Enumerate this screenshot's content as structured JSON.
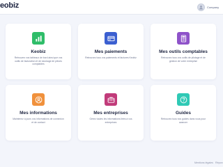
{
  "header": {
    "logo_text": "eobiz",
    "company_label": "Company"
  },
  "cards": [
    {
      "title": "Keobiz",
      "description": "Retrouvez vos tableaux de bord ainsi que vos outils de facturation et de stockage de pièces comptables",
      "color": "#2fbd69",
      "icon": "bar-chart-icon"
    },
    {
      "title": "Mes paiements",
      "description": "Retrouvez tous vos paiements et factures Keobiz",
      "color": "#3b5fd0",
      "icon": "credit-card-icon"
    },
    {
      "title": "Mes outils comptables",
      "description": "Retrouvez tous vos outils de pilotage et de gestion de votre entreprise",
      "color": "#8e52c9",
      "icon": "calculator-icon"
    },
    {
      "title": "Mes informations",
      "description": "Maintenez à jours vos informations de connexion et de contact",
      "color": "#f0913c",
      "icon": "user-icon"
    },
    {
      "title": "Mes entreprises",
      "description": "Gérez toutes les informations liées à vos entreprises",
      "color": "#c13b7a",
      "icon": "briefcase-icon"
    },
    {
      "title": "Guides",
      "description": "Retrouvez tous nos guides dans vous pour avancer",
      "color": "#2fc9b5",
      "icon": "help-circle-icon"
    }
  ],
  "footer": {
    "legal_label": "Mentions légales",
    "right_label": "Répon"
  }
}
